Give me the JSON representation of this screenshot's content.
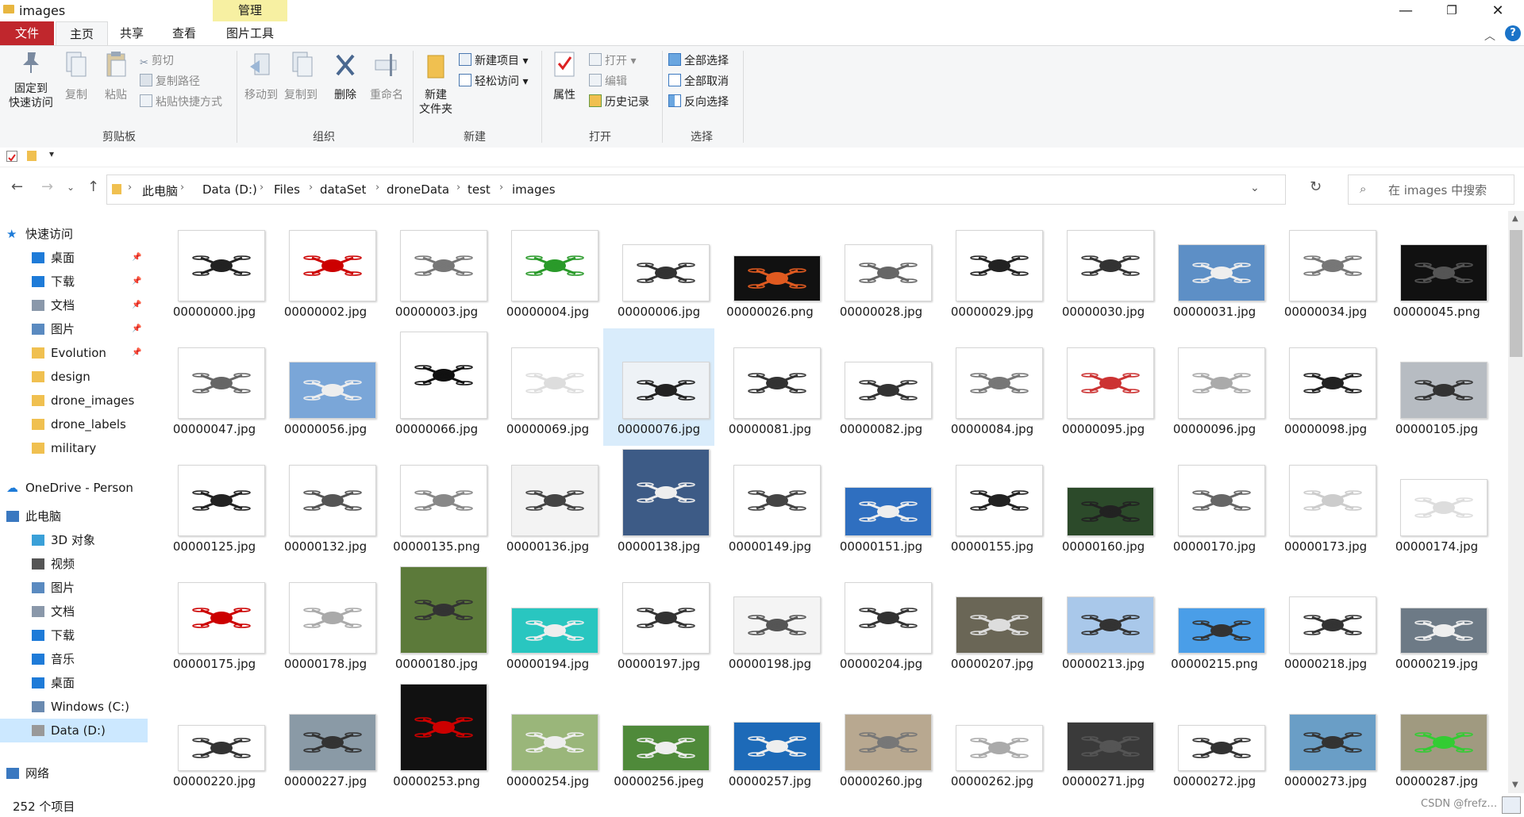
{
  "window": {
    "title": "images",
    "minimize": "—",
    "maximize": "❐",
    "close": "✕"
  },
  "contextual_tab_header": "管理",
  "tabs": {
    "file": "文件",
    "home": "主页",
    "share": "共享",
    "view": "查看",
    "picture_tools": "图片工具"
  },
  "ribbon": {
    "clipboard": {
      "pin_line1": "固定到",
      "pin_line2": "快速访问",
      "copy": "复制",
      "paste": "粘贴",
      "cut": "剪切",
      "copy_path": "复制路径",
      "paste_shortcut": "粘贴快捷方式",
      "label": "剪贴板"
    },
    "organize": {
      "move_to": "移动到",
      "copy_to": "复制到",
      "delete": "删除",
      "rename": "重命名",
      "label": "组织"
    },
    "new": {
      "new_folder_line1": "新建",
      "new_folder_line2": "文件夹",
      "new_item": "新建项目 ▾",
      "easy_access": "轻松访问 ▾",
      "label": "新建"
    },
    "open": {
      "properties": "属性",
      "open": "打开 ▾",
      "edit": "编辑",
      "history": "历史记录",
      "label": "打开"
    },
    "select": {
      "select_all": "全部选择",
      "select_none": "全部取消",
      "invert": "反向选择",
      "label": "选择"
    }
  },
  "address": {
    "crumbs": [
      "此电脑",
      "Data (D:)",
      "Files",
      "dataSet",
      "droneData",
      "test",
      "images"
    ],
    "search_placeholder": "在 images 中搜索"
  },
  "nav": {
    "quick_access": "快速访问",
    "quick_items": [
      "桌面",
      "下载",
      "文档",
      "图片",
      "Evolution",
      "design",
      "drone_images",
      "drone_labels",
      "military"
    ],
    "onedrive": "OneDrive - Person",
    "this_pc": "此电脑",
    "pc_items": [
      "3D 对象",
      "视频",
      "图片",
      "文档",
      "下载",
      "音乐",
      "桌面",
      "Windows (C:)",
      "Data (D:)"
    ],
    "network": "网络"
  },
  "files": [
    "00000000.jpg",
    "00000002.jpg",
    "00000003.jpg",
    "00000004.jpg",
    "00000006.jpg",
    "00000026.png",
    "00000028.jpg",
    "00000029.jpg",
    "00000030.jpg",
    "00000031.jpg",
    "00000034.jpg",
    "00000045.png",
    "00000047.jpg",
    "00000056.jpg",
    "00000066.jpg",
    "00000069.jpg",
    "00000076.jpg",
    "00000081.jpg",
    "00000082.jpg",
    "00000084.jpg",
    "00000095.jpg",
    "00000096.jpg",
    "00000098.jpg",
    "00000105.jpg",
    "00000125.jpg",
    "00000132.jpg",
    "00000135.png",
    "00000136.jpg",
    "00000138.jpg",
    "00000149.jpg",
    "00000151.jpg",
    "00000155.jpg",
    "00000160.jpg",
    "00000170.jpg",
    "00000173.jpg",
    "00000174.jpg",
    "00000175.jpg",
    "00000178.jpg",
    "00000180.jpg",
    "00000194.jpg",
    "00000197.jpg",
    "00000198.jpg",
    "00000204.jpg",
    "00000207.jpg",
    "00000213.jpg",
    "00000215.png",
    "00000218.jpg",
    "00000219.jpg",
    "00000220.jpg",
    "00000227.jpg",
    "00000253.png",
    "00000254.jpg",
    "00000256.jpeg",
    "00000257.jpg",
    "00000260.jpg",
    "00000262.jpg",
    "00000271.jpg",
    "00000272.jpg",
    "00000273.jpg",
    "00000287.jpg"
  ],
  "selected_file": "00000076.jpg",
  "status": {
    "count": "252 个项目",
    "watermark": "CSDN @frefz…"
  }
}
